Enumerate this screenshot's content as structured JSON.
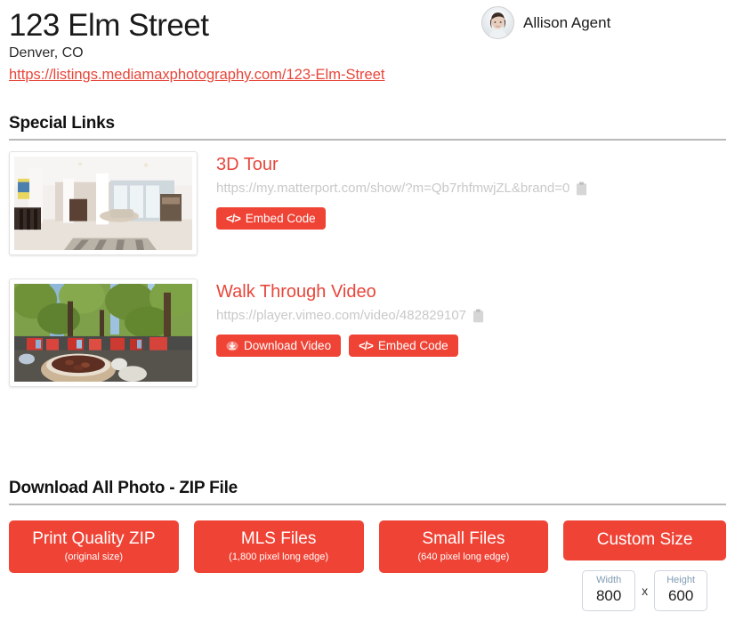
{
  "header": {
    "address_title": "123 Elm Street",
    "city_state": "Denver, CO",
    "listing_url": "https://listings.mediamaxphotography.com/123-Elm-Street",
    "agent_name": "Allison Agent",
    "avatar_icon": "agent-headshot"
  },
  "special_links": {
    "section_title": "Special Links",
    "items": [
      {
        "title": "3D Tour",
        "url": "https://my.matterport.com/show/?m=Qb7rhfmwjZL&brand=0",
        "copy_icon": "clipboard-icon",
        "thumbnail_alt": "interior-living-room-photo",
        "buttons": [
          {
            "label": "Embed Code",
            "icon": "code-icon"
          }
        ]
      },
      {
        "title": "Walk Through Video",
        "url": "https://player.vimeo.com/video/482829107",
        "copy_icon": "clipboard-icon",
        "thumbnail_alt": "outdoor-patio-firepit-photo",
        "buttons": [
          {
            "label": "Download Video",
            "icon": "download-icon"
          },
          {
            "label": "Embed Code",
            "icon": "code-icon"
          }
        ]
      }
    ]
  },
  "zip_section": {
    "section_title": "Download All Photo - ZIP File",
    "buttons": [
      {
        "label": "Print Quality ZIP",
        "sublabel": "(original size)"
      },
      {
        "label": "MLS Files",
        "sublabel": "(1,800 pixel long edge)"
      },
      {
        "label": "Small Files",
        "sublabel": "(640 pixel long edge)"
      }
    ],
    "custom": {
      "label": "Custom Size",
      "width_label": "Width",
      "width_value": "800",
      "separator": "x",
      "height_label": "Height",
      "height_value": "600"
    }
  },
  "colors": {
    "accent_red": "#ef4335",
    "link_red": "#e8463a",
    "muted_url": "#c9c9c9",
    "divider": "#b9b9b9",
    "input_border": "#cfd6dd",
    "input_label": "#7f9bb3"
  }
}
